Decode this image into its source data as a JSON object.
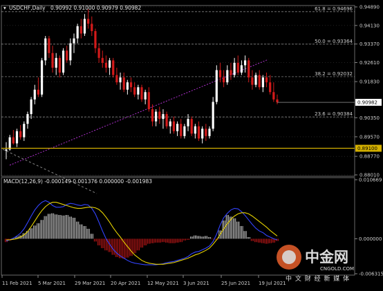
{
  "chart_data": {
    "type": "candlestick",
    "header": {
      "symbol": "USDCHF,Daily",
      "ohlc": "0.90992 0.91000 0.90979 0.90982"
    },
    "price_axis": {
      "ticks": [
        "0.94890",
        "0.94130",
        "0.93370",
        "0.92610",
        "0.91830",
        "0.90350",
        "0.89570",
        "0.88770",
        "0.88010"
      ],
      "ylim": [
        0.8801,
        0.9489
      ]
    },
    "time_axis": {
      "labels": [
        "11 Feb 2021",
        "5 Mar 2021",
        "29 Mar 2021",
        "20 Apr 2021",
        "12 May 2021",
        "3 Jun 2021",
        "25 Jun 2021",
        "19 Jul 2021"
      ]
    },
    "fibonacci_levels": [
      {
        "label": "61.8 = 0.94696",
        "value": 0.94696
      },
      {
        "label": "50.0 = 0.93364",
        "value": 0.93364
      },
      {
        "label": "38.2 = 0.92032",
        "value": 0.92032
      },
      {
        "label": "23.6 = 0.90384",
        "value": 0.90384
      }
    ],
    "current_price": {
      "label": "0.90982",
      "value": 0.90982
    },
    "support_level": {
      "label": "0.89100",
      "value": 0.891,
      "color": "#d4b000"
    },
    "candles": [
      [
        0.89,
        0.8935,
        0.8865,
        0.8905
      ],
      [
        0.8905,
        0.8965,
        0.89,
        0.8955
      ],
      [
        0.8955,
        0.8985,
        0.8925,
        0.893
      ],
      [
        0.893,
        0.899,
        0.8915,
        0.898
      ],
      [
        0.898,
        0.9005,
        0.8945,
        0.8955
      ],
      [
        0.8955,
        0.902,
        0.894,
        0.901
      ],
      [
        0.901,
        0.906,
        0.899,
        0.905
      ],
      [
        0.905,
        0.912,
        0.903,
        0.911
      ],
      [
        0.911,
        0.917,
        0.909,
        0.915
      ],
      [
        0.915,
        0.92,
        0.912,
        0.913
      ],
      [
        0.913,
        0.928,
        0.912,
        0.927
      ],
      [
        0.927,
        0.937,
        0.925,
        0.936
      ],
      [
        0.936,
        0.937,
        0.928,
        0.93
      ],
      [
        0.93,
        0.933,
        0.922,
        0.924
      ],
      [
        0.924,
        0.93,
        0.921,
        0.928
      ],
      [
        0.928,
        0.929,
        0.92,
        0.922
      ],
      [
        0.922,
        0.932,
        0.921,
        0.931
      ],
      [
        0.931,
        0.933,
        0.926,
        0.927
      ],
      [
        0.927,
        0.936,
        0.925,
        0.934
      ],
      [
        0.934,
        0.938,
        0.93,
        0.936
      ],
      [
        0.936,
        0.942,
        0.934,
        0.941
      ],
      [
        0.941,
        0.944,
        0.936,
        0.938
      ],
      [
        0.938,
        0.946,
        0.937,
        0.944
      ],
      [
        0.944,
        0.948,
        0.94,
        0.942
      ],
      [
        0.942,
        0.945,
        0.937,
        0.939
      ],
      [
        0.939,
        0.94,
        0.93,
        0.932
      ],
      [
        0.932,
        0.934,
        0.926,
        0.928
      ],
      [
        0.928,
        0.931,
        0.924,
        0.926
      ],
      [
        0.926,
        0.929,
        0.922,
        0.924
      ],
      [
        0.924,
        0.928,
        0.921,
        0.927
      ],
      [
        0.927,
        0.928,
        0.92,
        0.921
      ],
      [
        0.921,
        0.924,
        0.917,
        0.918
      ],
      [
        0.918,
        0.922,
        0.915,
        0.92
      ],
      [
        0.92,
        0.922,
        0.914,
        0.915
      ],
      [
        0.915,
        0.919,
        0.913,
        0.918
      ],
      [
        0.918,
        0.92,
        0.914,
        0.916
      ],
      [
        0.916,
        0.918,
        0.912,
        0.913
      ],
      [
        0.913,
        0.917,
        0.911,
        0.916
      ],
      [
        0.916,
        0.917,
        0.91,
        0.911
      ],
      [
        0.911,
        0.915,
        0.909,
        0.914
      ],
      [
        0.914,
        0.916,
        0.906,
        0.907
      ],
      [
        0.907,
        0.909,
        0.9,
        0.902
      ],
      [
        0.902,
        0.907,
        0.9,
        0.906
      ],
      [
        0.906,
        0.908,
        0.901,
        0.903
      ],
      [
        0.903,
        0.907,
        0.899,
        0.905
      ],
      [
        0.905,
        0.906,
        0.899,
        0.9
      ],
      [
        0.9,
        0.903,
        0.897,
        0.902
      ],
      [
        0.902,
        0.904,
        0.897,
        0.898
      ],
      [
        0.898,
        0.902,
        0.896,
        0.901
      ],
      [
        0.901,
        0.903,
        0.895,
        0.896
      ],
      [
        0.896,
        0.901,
        0.895,
        0.9
      ],
      [
        0.9,
        0.905,
        0.898,
        0.903
      ],
      [
        0.903,
        0.904,
        0.896,
        0.897
      ],
      [
        0.897,
        0.901,
        0.895,
        0.9
      ],
      [
        0.9,
        0.902,
        0.894,
        0.895
      ],
      [
        0.895,
        0.9,
        0.893,
        0.899
      ],
      [
        0.899,
        0.901,
        0.894,
        0.896
      ],
      [
        0.896,
        0.9,
        0.895,
        0.899
      ],
      [
        0.899,
        0.912,
        0.898,
        0.91
      ],
      [
        0.91,
        0.925,
        0.909,
        0.923
      ],
      [
        0.923,
        0.926,
        0.918,
        0.92
      ],
      [
        0.92,
        0.923,
        0.916,
        0.918
      ],
      [
        0.918,
        0.925,
        0.917,
        0.923
      ],
      [
        0.923,
        0.926,
        0.919,
        0.921
      ],
      [
        0.921,
        0.928,
        0.92,
        0.926
      ],
      [
        0.926,
        0.929,
        0.921,
        0.922
      ],
      [
        0.922,
        0.927,
        0.921,
        0.925
      ],
      [
        0.925,
        0.929,
        0.922,
        0.927
      ],
      [
        0.927,
        0.928,
        0.918,
        0.92
      ],
      [
        0.92,
        0.923,
        0.915,
        0.917
      ],
      [
        0.917,
        0.922,
        0.916,
        0.921
      ],
      [
        0.921,
        0.923,
        0.915,
        0.916
      ],
      [
        0.916,
        0.921,
        0.914,
        0.92
      ],
      [
        0.92,
        0.922,
        0.916,
        0.918
      ],
      [
        0.918,
        0.921,
        0.913,
        0.914
      ],
      [
        0.914,
        0.918,
        0.91,
        0.911
      ],
      [
        0.911,
        0.913,
        0.909,
        0.90982
      ]
    ],
    "macd": {
      "title": "MACD(12,26,9) -0.000149 0.001376 0.000000 -0.001983",
      "ticks": [
        "0.010669",
        "0.000000",
        "-0.006315"
      ],
      "ylim": [
        -0.006315,
        0.010669
      ],
      "histogram": [
        -0.0006,
        -0.0003,
        0.0001,
        0.0004,
        0.0006,
        0.001,
        0.0014,
        0.0019,
        0.0024,
        0.0028,
        0.0034,
        0.0041,
        0.0045,
        0.0046,
        0.0044,
        0.0043,
        0.0042,
        0.0043,
        0.004,
        0.0038,
        0.0031,
        0.0026,
        0.0023,
        0.0018,
        0.0009,
        -0.0005,
        -0.0012,
        -0.0017,
        -0.0021,
        -0.0024,
        -0.0029,
        -0.0033,
        -0.0035,
        -0.0036,
        -0.0034,
        -0.0031,
        -0.0026,
        -0.0021,
        -0.0016,
        -0.0012,
        -0.0009,
        -0.0008,
        -0.0007,
        -0.0007,
        -0.0006,
        -0.0007,
        -0.0008,
        -0.0008,
        -0.0007,
        -0.0006,
        -0.0003,
        -0.0002,
        0.0004,
        0.0006,
        0.0005,
        0.0004,
        0.0005,
        0.0003,
        -0.0001,
        -0.0002,
        0.0015,
        0.0033,
        0.0043,
        0.004,
        0.0037,
        0.0031,
        0.0023,
        0.0014,
        0.0003,
        -0.0004,
        -0.0006,
        -0.0007,
        -0.0008,
        -0.0009,
        -0.0008,
        -0.0007,
        -0.0004
      ],
      "macd_line": [
        -0.0004,
        -0.0002,
        0.0001,
        0.0005,
        0.001,
        0.0018,
        0.0029,
        0.0041,
        0.0052,
        0.006,
        0.0066,
        0.0069,
        0.0066,
        0.006,
        0.0057,
        0.0057,
        0.0058,
        0.0062,
        0.0064,
        0.0063,
        0.0061,
        0.006,
        0.0062,
        0.0061,
        0.0055,
        0.0045,
        0.003,
        0.0014,
        0.0,
        -0.001,
        -0.0019,
        -0.0026,
        -0.0031,
        -0.0035,
        -0.0039,
        -0.0042,
        -0.0044,
        -0.0045,
        -0.0046,
        -0.0047,
        -0.0047,
        -0.0047,
        -0.0047,
        -0.0046,
        -0.0045,
        -0.0043,
        -0.0042,
        -0.0041,
        -0.0039,
        -0.0037,
        -0.0035,
        -0.0032,
        -0.0027,
        -0.0024,
        -0.0023,
        -0.002,
        -0.0017,
        -0.0013,
        -0.0005,
        0.0008,
        0.0025,
        0.0038,
        0.0046,
        0.0052,
        0.0055,
        0.0054,
        0.0049,
        0.0042,
        0.0034,
        0.0026,
        0.0019,
        0.0014,
        0.0011,
        0.0006,
        0.0003,
        0.0,
        -0.0002
      ],
      "signal_line": [
        -0.0002,
        -0.0002,
        -0.0001,
        0.0,
        0.0003,
        0.0007,
        0.0013,
        0.0022,
        0.0032,
        0.0042,
        0.0051,
        0.0058,
        0.0063,
        0.0066,
        0.0066,
        0.0064,
        0.0062,
        0.006,
        0.0058,
        0.0056,
        0.0055,
        0.0055,
        0.0056,
        0.0057,
        0.0057,
        0.0056,
        0.0053,
        0.0047,
        0.0039,
        0.003,
        0.002,
        0.0011,
        0.0003,
        -0.0006,
        -0.0014,
        -0.0022,
        -0.0029,
        -0.0034,
        -0.0039,
        -0.0042,
        -0.0044,
        -0.0045,
        -0.0046,
        -0.0046,
        -0.0046,
        -0.0045,
        -0.0044,
        -0.0043,
        -0.0041,
        -0.0039,
        -0.0037,
        -0.0035,
        -0.0032,
        -0.0029,
        -0.0027,
        -0.0024,
        -0.0021,
        -0.0017,
        -0.001,
        -0.0002,
        0.0008,
        0.0018,
        0.0027,
        0.0035,
        0.0041,
        0.0045,
        0.0047,
        0.0047,
        0.0045,
        0.0041,
        0.0036,
        0.0031,
        0.0026,
        0.0021,
        0.0015,
        0.001,
        0.0005
      ],
      "colors": {
        "macd_line": "#3344ff",
        "signal_line": "#e6d200",
        "histogram_up": "#e0e0e0",
        "histogram_down": "#d41a1a"
      }
    },
    "colors": {
      "bull": "#ffffff",
      "bear": "#d41a1a",
      "grid": "#3a3a3a",
      "fib": "#9a9a9a",
      "trendline": "#b030d0",
      "background": "#000000"
    }
  },
  "watermark": {
    "brand": "中金网",
    "domain": "CNGOLD.COM",
    "tagline": "中 文 财 经 新 媒 体"
  }
}
